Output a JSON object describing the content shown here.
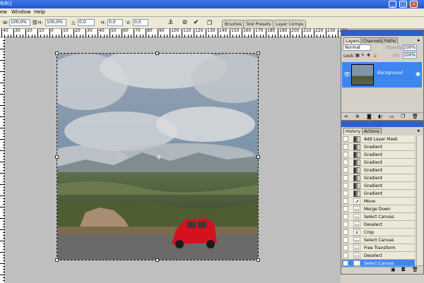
{
  "titlebar": {
    "title": "8/8)]",
    "minimize": "_",
    "maximize": "□",
    "close": "×"
  },
  "menu": [
    "ew",
    "Window",
    "Help"
  ],
  "options": {
    "w_label": "W:",
    "w_value": "100,0%",
    "h_label": "H:",
    "h_value": "100,0%",
    "angle_value": "0,0",
    "hskew_label": "H:",
    "hskew_value": "0,0",
    "vskew_label": "V:",
    "vskew_value": "0,0"
  },
  "dock_tabs": [
    "Brushes",
    "Tool Presets",
    "Layer Comps"
  ],
  "ruler": {
    "top": [
      "40",
      "30",
      "20",
      "10",
      "0",
      "10",
      "20",
      "30",
      "40",
      "50",
      "60",
      "70",
      "80",
      "90",
      "100",
      "110",
      "120",
      "130",
      "140",
      "150",
      "160",
      "170",
      "180",
      "190",
      "200",
      "210",
      "220",
      "230",
      "240"
    ]
  },
  "layers_panel": {
    "tabs": [
      "Layers",
      "Channels",
      "Paths"
    ],
    "blend_mode": "Normal",
    "opacity_label": "Opacity:",
    "opacity_value": "100%",
    "lock_label": "Lock:",
    "fill_label": "Fill:",
    "fill_value": "100%",
    "layer_name": "Background"
  },
  "history_panel": {
    "tabs": [
      "History",
      "Actions"
    ],
    "items": [
      {
        "label": "Add Layer Mask",
        "icon": "gradient-icon"
      },
      {
        "label": "Gradient",
        "icon": "gradient-icon"
      },
      {
        "label": "Gradient",
        "icon": "gradient-icon"
      },
      {
        "label": "Gradient",
        "icon": "gradient-icon"
      },
      {
        "label": "Gradient",
        "icon": "gradient-icon"
      },
      {
        "label": "Gradient",
        "icon": "gradient-icon"
      },
      {
        "label": "Gradient",
        "icon": "gradient-icon"
      },
      {
        "label": "Gradient",
        "icon": "gradient-icon"
      },
      {
        "label": "Move",
        "icon": "move-icon"
      },
      {
        "label": "Merge Down",
        "icon": "document-icon"
      },
      {
        "label": "Select Canvas",
        "icon": "document-icon"
      },
      {
        "label": "Deselect",
        "icon": "document-icon"
      },
      {
        "label": "Crop",
        "icon": "crop-icon"
      },
      {
        "label": "Select Canvas",
        "icon": "document-icon"
      },
      {
        "label": "Free Transform",
        "icon": "document-icon"
      },
      {
        "label": "Deselect",
        "icon": "document-icon"
      },
      {
        "label": "Select Canvas",
        "icon": "document-icon"
      }
    ],
    "selected_index": 16
  },
  "colors": {
    "accent": "#3d86f0",
    "title_bar": "#2a5fcf",
    "car": "#d3111f"
  }
}
